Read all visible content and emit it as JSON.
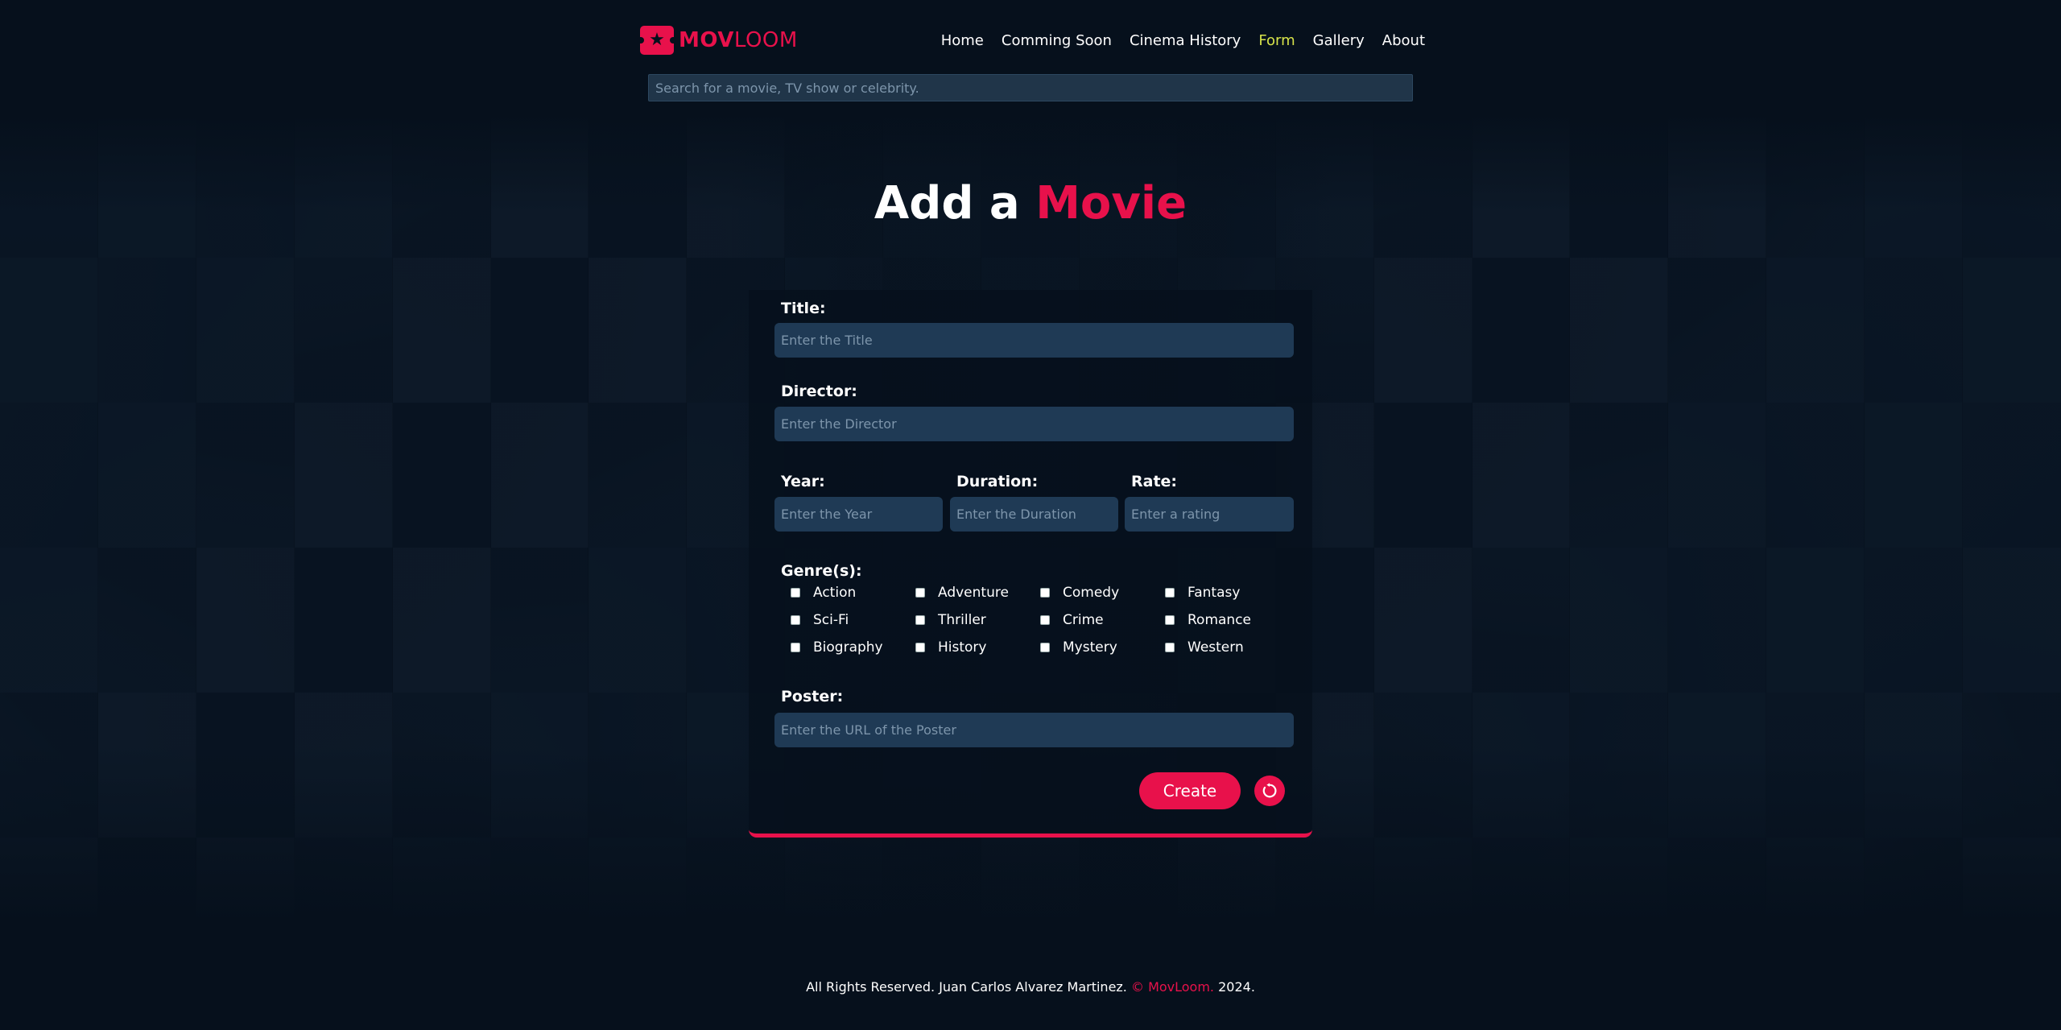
{
  "brand": {
    "part1": "MOV",
    "part2": "LOOM"
  },
  "nav": [
    {
      "label": "Home",
      "active": false
    },
    {
      "label": "Comming Soon",
      "active": false
    },
    {
      "label": "Cinema History",
      "active": false
    },
    {
      "label": "Form",
      "active": true
    },
    {
      "label": "Gallery",
      "active": false
    },
    {
      "label": "About",
      "active": false
    }
  ],
  "search": {
    "placeholder": "Search for a movie, TV show or celebrity."
  },
  "page": {
    "title_prefix": "Add a",
    "title_accent": "Movie"
  },
  "form": {
    "title_label": "Title:",
    "title_placeholder": "Enter the Title",
    "director_label": "Director:",
    "director_placeholder": "Enter the Director",
    "year_label": "Year:",
    "year_placeholder": "Enter the Year",
    "duration_label": "Duration:",
    "duration_placeholder": "Enter the Duration",
    "rate_label": "Rate:",
    "rate_placeholder": "Enter a rating",
    "genres_label": "Genre(s):",
    "genres": [
      "Action",
      "Adventure",
      "Comedy",
      "Fantasy",
      "Sci-Fi",
      "Thriller",
      "Crime",
      "Romance",
      "Biography",
      "History",
      "Mystery",
      "Western"
    ],
    "poster_label": "Poster:",
    "poster_placeholder": "Enter the URL of the Poster",
    "create_label": "Create",
    "reset_icon": "refresh-icon"
  },
  "footer": {
    "text": "All Rights Reserved. Juan Carlos Alvarez Martinez.",
    "accent": "© MovLoom.",
    "year": "2024."
  },
  "colors": {
    "accent": "#e8114b",
    "nav_active": "#d7e34a",
    "background": "#06101c",
    "field": "#1f3a55"
  }
}
